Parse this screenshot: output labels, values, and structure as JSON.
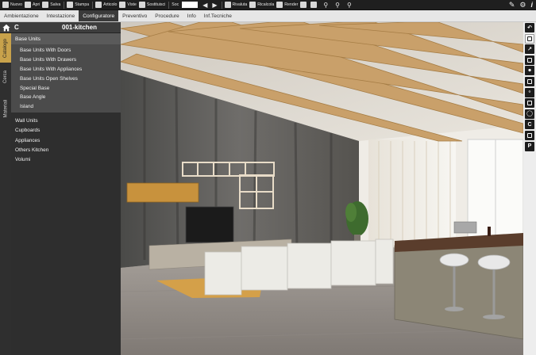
{
  "toolbar": {
    "items": [
      {
        "label": "Nuovo",
        "icon": "new-file-icon"
      },
      {
        "label": "Apri",
        "icon": "folder-icon"
      },
      {
        "label": "Salva",
        "icon": "save-icon"
      },
      {
        "label": "Stampa",
        "icon": "print-icon"
      },
      {
        "label": "Articolo",
        "icon": "article-icon"
      },
      {
        "label": "Viste",
        "icon": "views-icon"
      },
      {
        "label": "Sostituisci",
        "icon": "replace-icon"
      }
    ],
    "soc_label": "Soc",
    "soc_value": "",
    "render_items": [
      {
        "label": "Rivaluta",
        "icon": "revalue-icon"
      },
      {
        "label": "Ricalcola",
        "icon": "recalc-icon"
      },
      {
        "label": "Render",
        "icon": "render-icon"
      }
    ]
  },
  "menu": {
    "items": [
      "Ambientazione",
      "Intestazione",
      "Configuratore",
      "Preventivo",
      "Procedure",
      "Info",
      "Inf.Tecniche"
    ],
    "active": "Configuratore"
  },
  "sidebar": {
    "code": "C",
    "title": "001-kitchen",
    "tabs": [
      "Catalogo",
      "Cerca",
      "Materiali"
    ],
    "active_tab": "Catalogo",
    "category": "Base Units",
    "sub_items": [
      "Base Units With Doors",
      "Base Units With Drawers",
      "Base Units With Appliances",
      "Base Units Open Shelves",
      "Special Base",
      "Base Angle",
      "Island"
    ],
    "items": [
      "Wall Units",
      "Cupboards",
      "Appliances",
      "Others Kitchen",
      "Volumi"
    ]
  },
  "right_tools": [
    "undo-icon",
    "hand-icon",
    "measure-icon",
    "ruler-icon",
    "light-bulb-icon",
    "layout-icon",
    "microphone-icon",
    "camera-icon",
    "sphere-icon",
    "c-icon",
    "export-icon",
    "p-icon"
  ],
  "colors": {
    "accent": "#c8a24b",
    "toolbar_bg": "#1f1f1f",
    "menu_bg": "#e6e6e6",
    "sidebar_bg": "#2e2e2e"
  }
}
